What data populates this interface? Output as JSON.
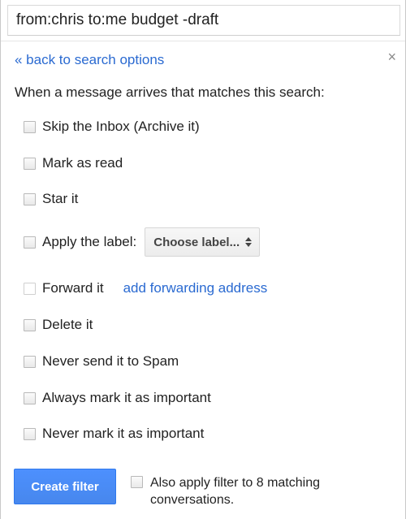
{
  "search": {
    "query": "from:chris to:me budget -draft"
  },
  "nav": {
    "back_label": "« back to search options",
    "close_glyph": "×"
  },
  "intro_text": "When a message arrives that matches this search:",
  "options": {
    "skip_inbox": "Skip the Inbox (Archive it)",
    "mark_read": "Mark as read",
    "star_it": "Star it",
    "apply_label": "Apply the label:",
    "forward_it": "Forward it",
    "delete_it": "Delete it",
    "never_spam": "Never send it to Spam",
    "always_important": "Always mark it as important",
    "never_important": "Never mark it as important"
  },
  "label_select": {
    "selected": "Choose label..."
  },
  "forwarding": {
    "link_label": "add forwarding address"
  },
  "footer": {
    "create_button": "Create filter",
    "also_apply": "Also apply filter to 8 matching conversations."
  },
  "colors": {
    "link": "#2a6ad1",
    "primary_button": "#4d90fe",
    "close_icon": "#8a8a8a"
  }
}
